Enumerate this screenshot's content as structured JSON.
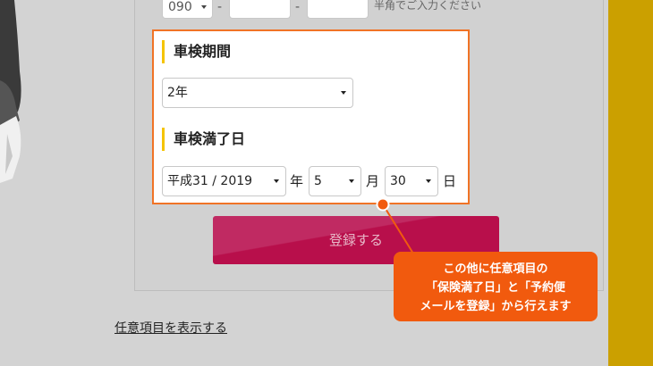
{
  "phone": {
    "area_code": "090",
    "separator": "-",
    "note": "半角でご入力ください"
  },
  "inspection_period": {
    "title": "車検期間",
    "selected": "2年"
  },
  "inspection_expiry": {
    "title": "車検満了日",
    "year": "平成31 / 2019",
    "year_unit": "年",
    "month": "5",
    "month_unit": "月",
    "day": "30",
    "day_unit": "日"
  },
  "register_button": "登録する",
  "show_optional_link": "任意項目を表示する",
  "callout": {
    "line1": "この他に任意項目の",
    "line2": "「保険満了日」と「予約便",
    "line3": "メールを登録」から行えます"
  },
  "colors": {
    "accent_orange": "#f07326",
    "title_bar_yellow": "#f5c400",
    "button_magenta": "#b80f4b",
    "right_bar": "#cba000"
  }
}
